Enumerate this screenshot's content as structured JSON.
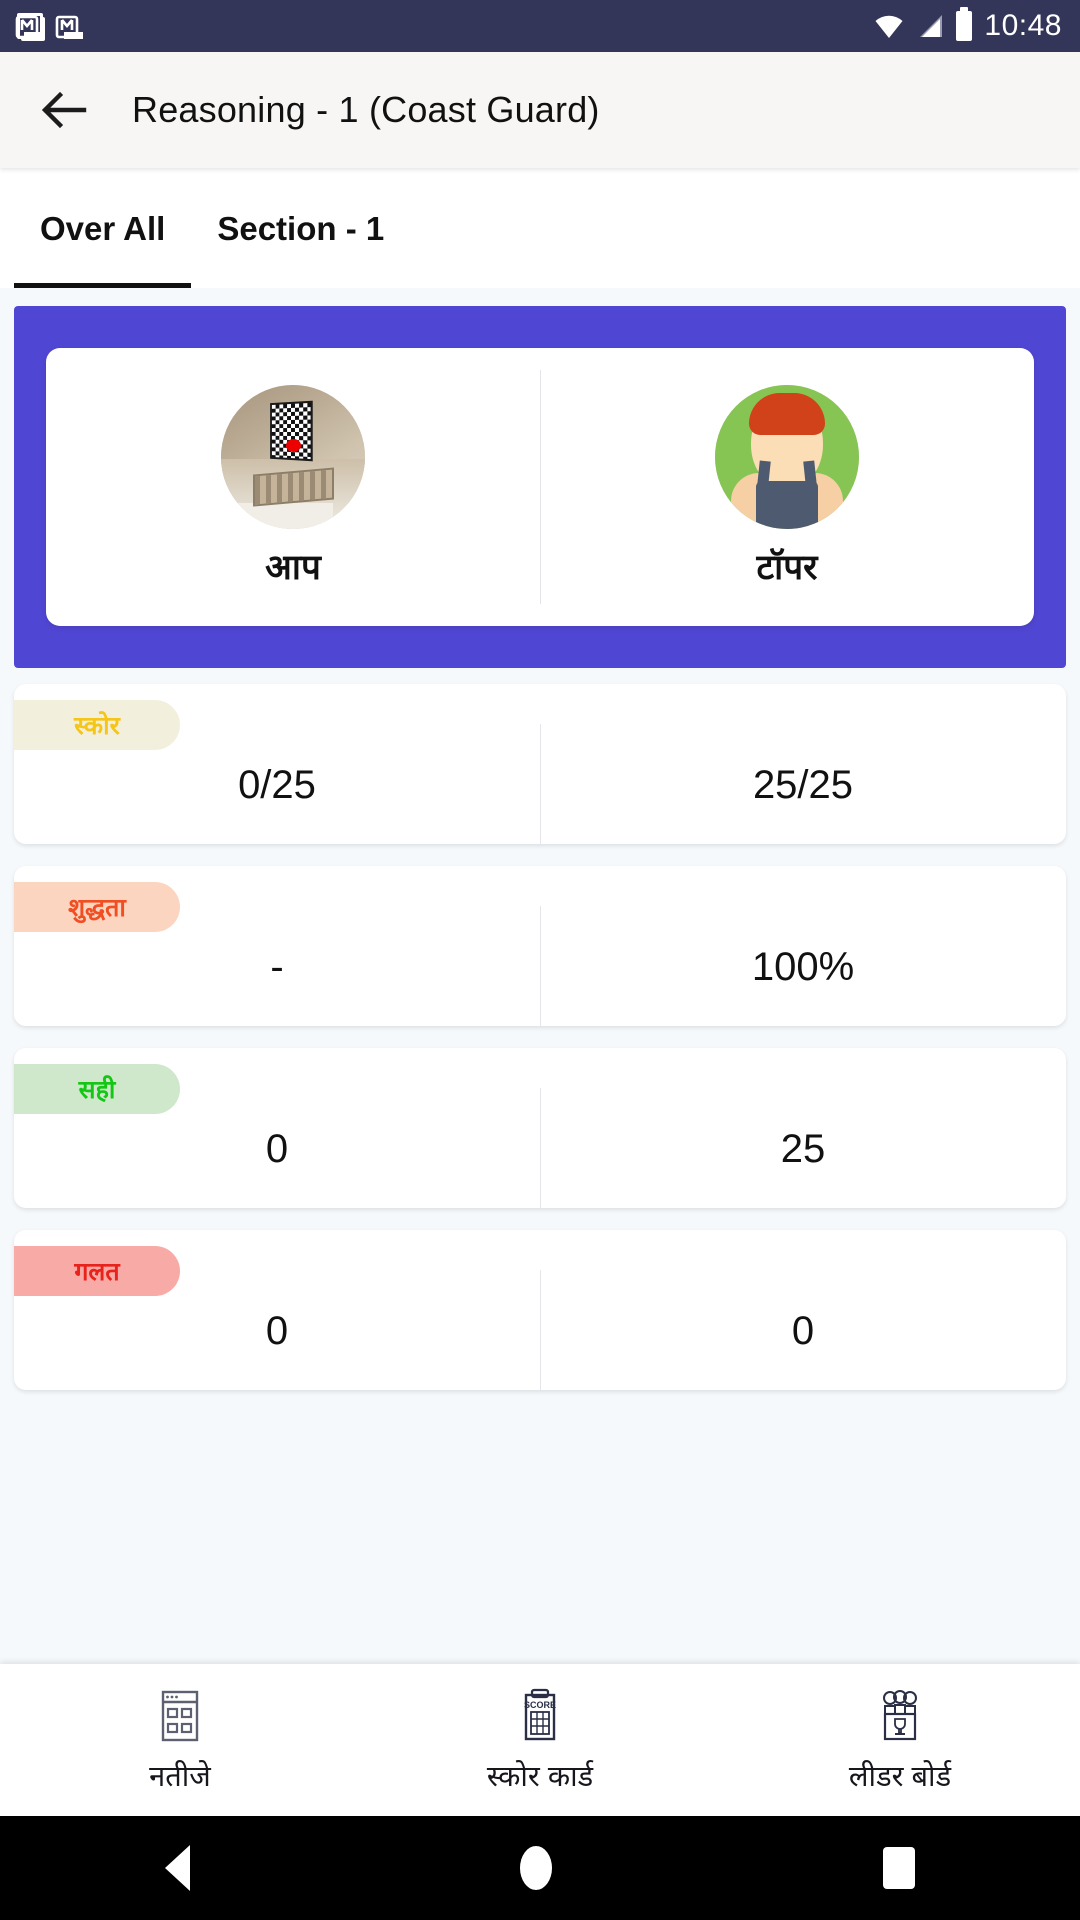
{
  "status_bar": {
    "time": "10:48",
    "icons": [
      "gmail-icon",
      "gmail-icon",
      "wifi-icon",
      "signal-icon",
      "battery-icon"
    ],
    "background": "#343659"
  },
  "app_bar": {
    "back_label": "back-arrow",
    "title": "Reasoning - 1 (Coast Guard)"
  },
  "tabs": [
    {
      "label": "Over All",
      "active": true
    },
    {
      "label": "Section - 1",
      "active": false
    }
  ],
  "hero": {
    "accent": "#5046d4",
    "columns": [
      {
        "label": "आप",
        "avatar": "user-photo-avatar"
      },
      {
        "label": "टॉपर",
        "avatar": "topper-illustration-avatar"
      }
    ]
  },
  "stats": [
    {
      "badge": "स्कोर",
      "badge_bg": "#f2f0dd",
      "badge_color": "#f5c518",
      "you": "0/25",
      "topper": "25/25"
    },
    {
      "badge": "शुद्धता",
      "badge_bg": "#fcd5c0",
      "badge_color": "#f04e23",
      "you": "-",
      "topper": "100%"
    },
    {
      "badge": "सही",
      "badge_bg": "#cfe7cb",
      "badge_color": "#14c714",
      "you": "0",
      "topper": "25"
    },
    {
      "badge": "गलत",
      "badge_bg": "#f8aaa6",
      "badge_color": "#e8231c",
      "you": "0",
      "topper": "0"
    }
  ],
  "bottom_nav": [
    {
      "label": "नतीजे",
      "icon": "results-grid-icon"
    },
    {
      "label": "स्कोर कार्ड",
      "icon": "score-clipboard-icon",
      "icon_text": "SCORE"
    },
    {
      "label": "लीडर बोर्ड",
      "icon": "leaderboard-podium-icon"
    }
  ],
  "system_nav": {
    "back": "back-triangle-icon",
    "home": "home-circle-icon",
    "recents": "recents-square-icon"
  }
}
